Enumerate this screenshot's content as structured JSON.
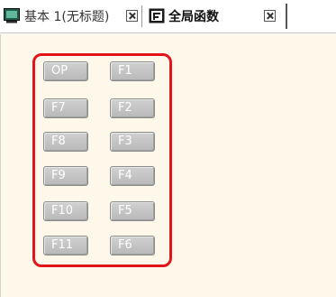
{
  "tabs": [
    {
      "label": "基本 1(无标题)",
      "icon": "screen-icon",
      "active": false
    },
    {
      "label": "全局函数",
      "icon": "function-window-icon",
      "active": true
    }
  ],
  "function_buttons": {
    "left": [
      "OP",
      "F7",
      "F8",
      "F9",
      "F10",
      "F11"
    ],
    "right": [
      "F1",
      "F2",
      "F3",
      "F4",
      "F5",
      "F6"
    ]
  },
  "colors": {
    "workspace": "#fdf8ea",
    "highlight": "#e3141a",
    "button_face": "#c4c4c4",
    "button_text": "#ffffff"
  }
}
